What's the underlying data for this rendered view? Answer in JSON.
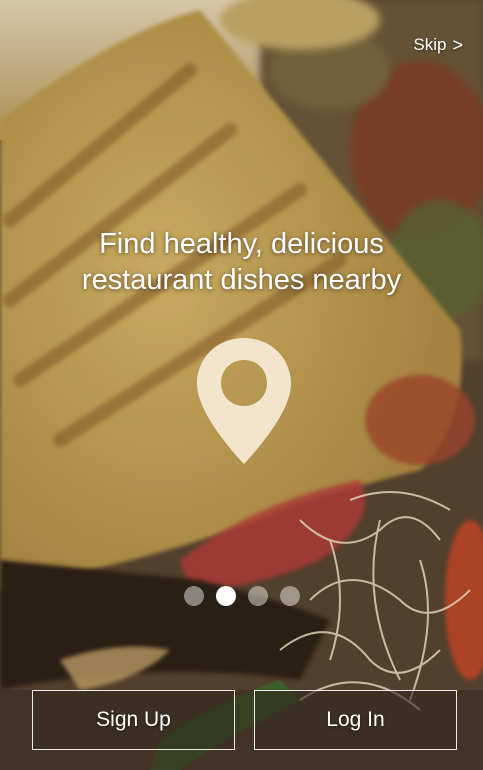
{
  "header": {
    "skip_label": "Skip",
    "skip_icon": "chevron-right-icon"
  },
  "onboarding": {
    "headline_line1": "Find healthy, delicious",
    "headline_line2": "restaurant dishes nearby",
    "icon": "location-pin-icon",
    "page_count": 4,
    "active_page": 2
  },
  "actions": {
    "signup_label": "Sign Up",
    "login_label": "Log In"
  },
  "colors": {
    "text": "#ffffff",
    "overlay_pin": "#f6ecd6",
    "bread": "#c9a659",
    "dark_bg": "#3b2e24"
  }
}
